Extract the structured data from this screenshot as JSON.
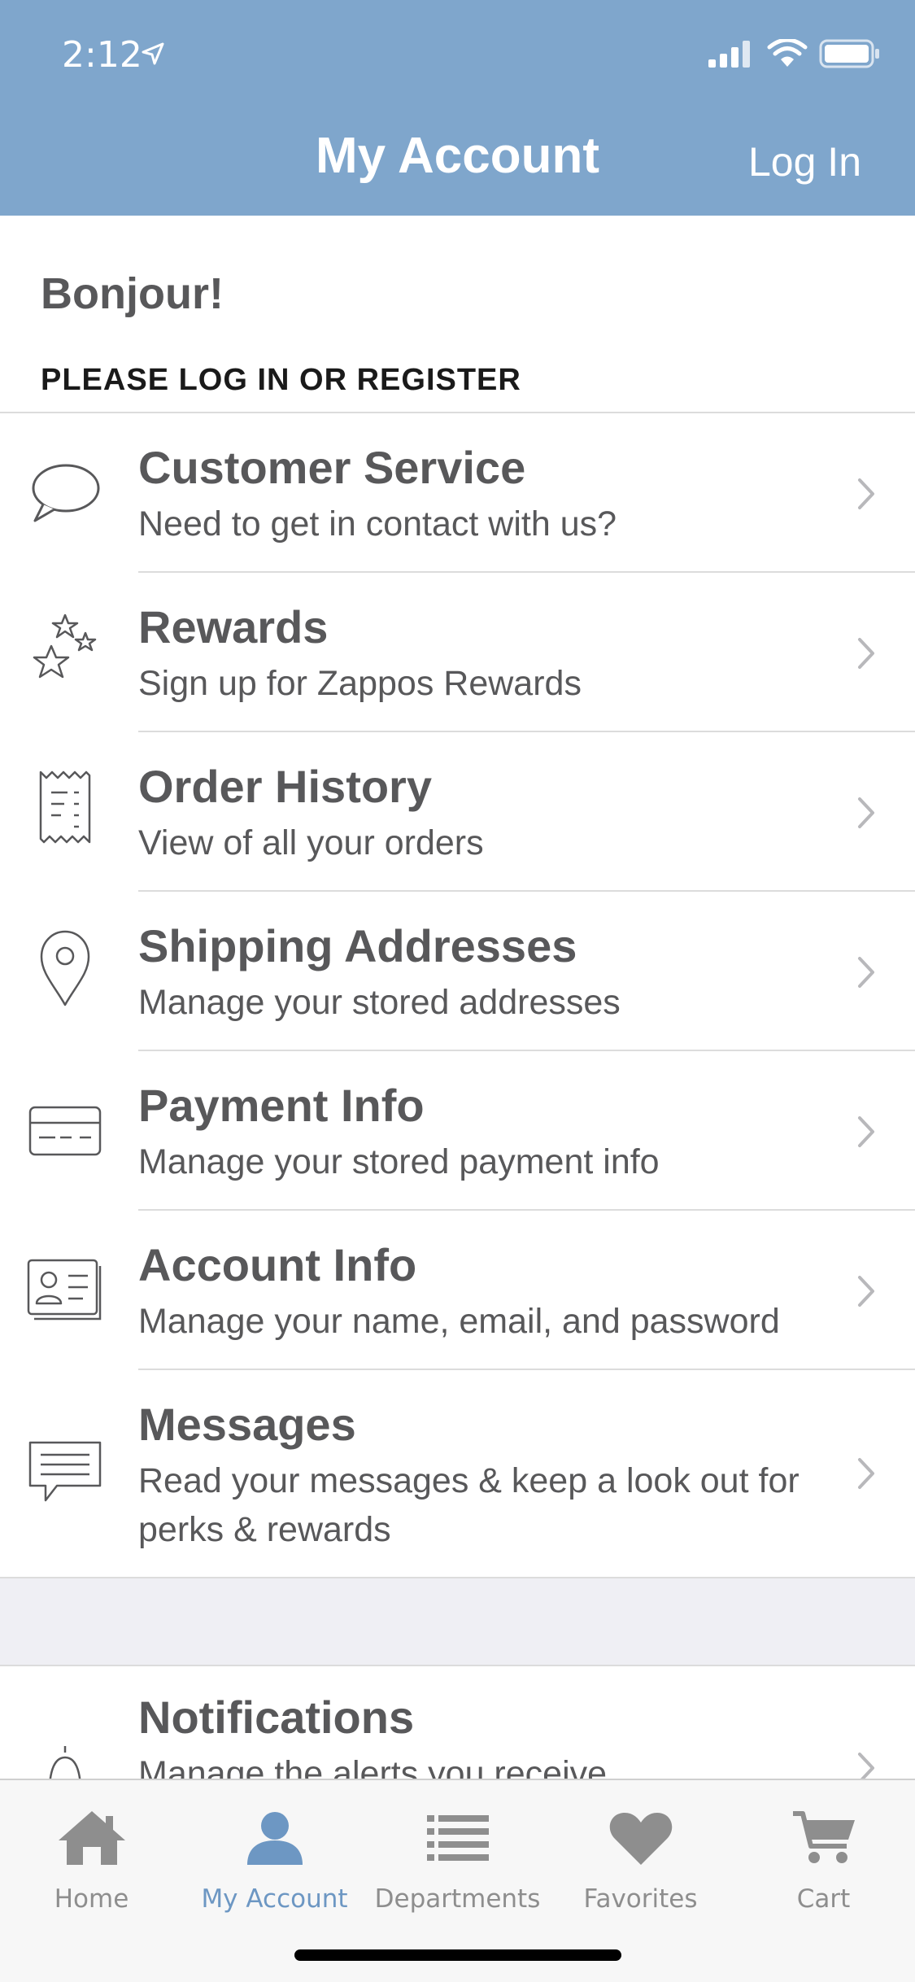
{
  "status_bar": {
    "time": "2:12"
  },
  "nav": {
    "title": "My Account",
    "login_label": "Log In"
  },
  "greeting": "Bonjour!",
  "subhead": "PLEASE LOG IN OR REGISTER",
  "rows": [
    {
      "title": "Customer Service",
      "desc": "Need to get in contact with us?",
      "icon": "speech-bubble-icon"
    },
    {
      "title": "Rewards",
      "desc": "Sign up for Zappos Rewards",
      "icon": "stars-icon"
    },
    {
      "title": "Order History",
      "desc": "View of all your orders",
      "icon": "receipt-icon"
    },
    {
      "title": "Shipping Addresses",
      "desc": "Manage your stored addresses",
      "icon": "map-pin-icon"
    },
    {
      "title": "Payment Info",
      "desc": "Manage your stored payment info",
      "icon": "credit-card-icon"
    },
    {
      "title": "Account Info",
      "desc": "Manage your name, email, and password",
      "icon": "id-card-icon"
    },
    {
      "title": "Messages",
      "desc": "Read your messages & keep a look out for perks & rewards",
      "icon": "message-icon"
    }
  ],
  "notifications": {
    "title": "Notifications",
    "desc": "Manage the alerts you receive",
    "icon": "bell-icon"
  },
  "tabs": [
    {
      "label": "Home",
      "icon": "home-icon"
    },
    {
      "label": "My Account",
      "icon": "user-icon",
      "active": true
    },
    {
      "label": "Departments",
      "icon": "list-icon"
    },
    {
      "label": "Favorites",
      "icon": "heart-icon"
    },
    {
      "label": "Cart",
      "icon": "cart-icon"
    }
  ],
  "colors": {
    "header": "#7fa6cc",
    "active_tab": "#6d97c3",
    "text": "#58585a"
  }
}
